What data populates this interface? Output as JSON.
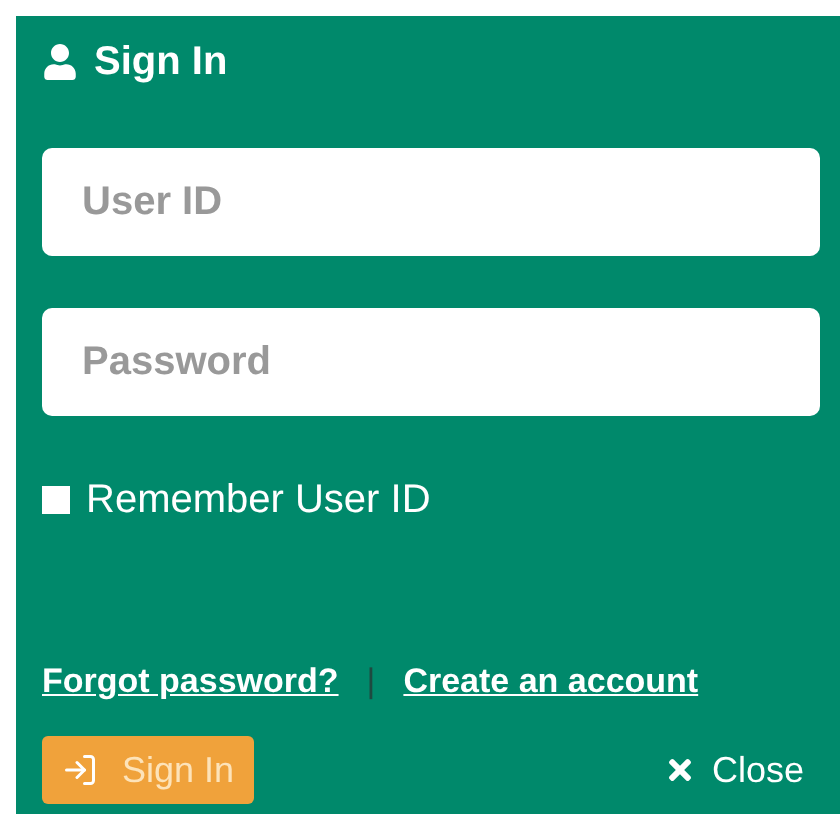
{
  "title": "Sign In",
  "fields": [
    {
      "placeholder": "User ID"
    },
    {
      "placeholder": "Password"
    }
  ],
  "remember": {
    "label": "Remember User ID",
    "checked": false
  },
  "links": [
    {
      "label": "Forgot password?"
    },
    {
      "label": "Create an account"
    }
  ],
  "link_separator": "|",
  "sign_in_button": "Sign In",
  "close_button": "Close"
}
